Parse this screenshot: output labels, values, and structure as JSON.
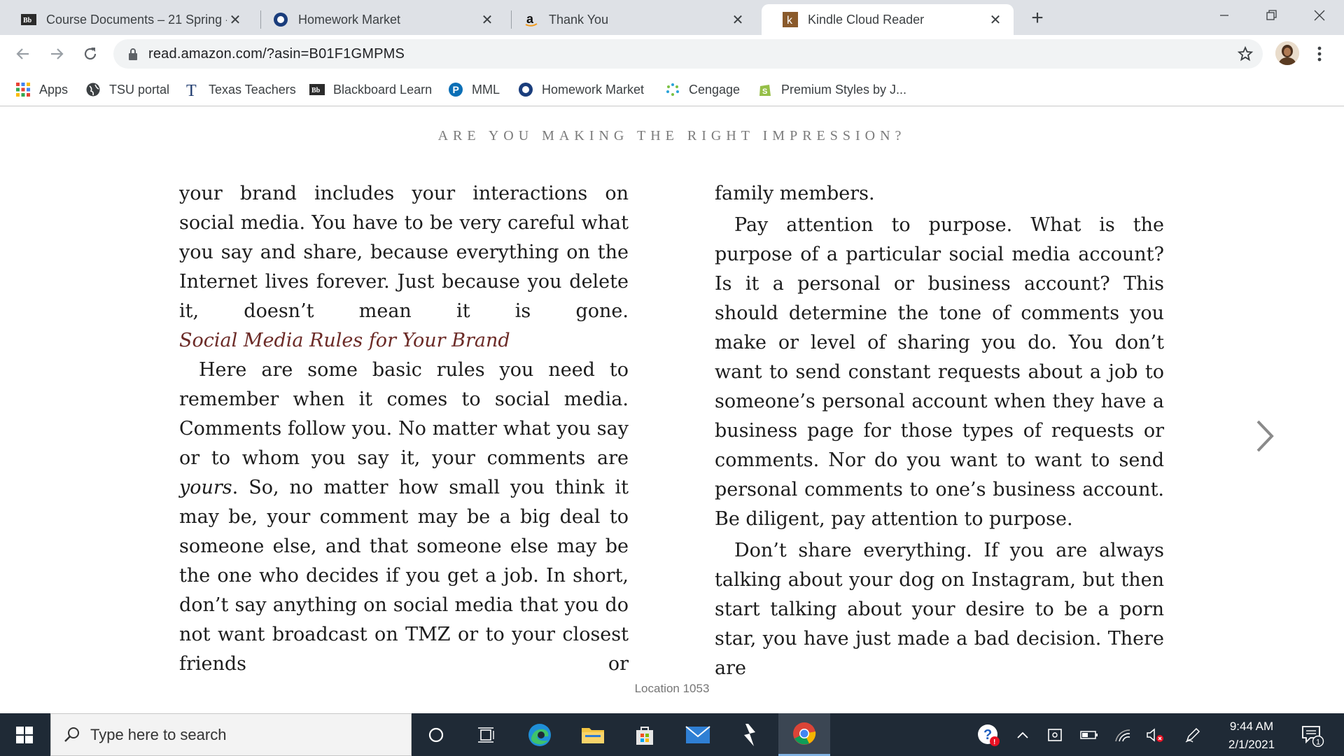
{
  "browser": {
    "tabs": [
      {
        "title": "Course Documents – 21 Spring -",
        "icon": "blackboard-icon",
        "active": false
      },
      {
        "title": "Homework Market",
        "icon": "homework-market-icon",
        "active": false
      },
      {
        "title": "Thank You",
        "icon": "amazon-icon",
        "active": false
      },
      {
        "title": "Kindle Cloud Reader",
        "icon": "kindle-icon",
        "active": true
      }
    ],
    "new_tab_symbol": "+",
    "close_symbol": "✕",
    "address": "read.amazon.com/?asin=B01F1GMPMS",
    "bookmarks": [
      {
        "label": "Apps",
        "icon": "apps-grid-icon"
      },
      {
        "label": "TSU portal",
        "icon": "globe-icon"
      },
      {
        "label": "Texas Teachers",
        "icon": "texas-teachers-icon"
      },
      {
        "label": "Blackboard Learn",
        "icon": "blackboard-icon"
      },
      {
        "label": "MML",
        "icon": "pearson-icon"
      },
      {
        "label": "Homework Market",
        "icon": "homework-market-icon"
      },
      {
        "label": "Cengage",
        "icon": "cengage-icon"
      },
      {
        "label": "Premium Styles by J...",
        "icon": "shopify-icon"
      }
    ]
  },
  "reader": {
    "running_head": "ARE YOU MAKING THE RIGHT IMPRESSION?",
    "left_column": {
      "para1_lines": [
        "your brand includes your interactions on social",
        "media. You have to be very careful what you say",
        "and share, because everything on the Internet",
        "lives forever. Just because you delete it, doesn’t",
        "mean it is gone."
      ],
      "heading": "Social Media Rules for Your Brand",
      "para2_lines": [
        "Here are some basic rules you need to",
        "remember when it comes to social media.",
        "Comments follow you. No matter what you say",
        "or to whom you say it, your comments are"
      ],
      "para2_em": "yours",
      "para2_after_em": ". So, no matter how small you think it may",
      "para2_rest_lines": [
        "be, your comment may be a big deal to someone",
        "else, and that someone else may be the one who",
        "decides if you get a job. In short, don’t say",
        "anything on social media that you do not want",
        "broadcast on TMZ or to your closest friends or"
      ]
    },
    "right_column": {
      "para1_lines": [
        "family members."
      ],
      "para2_lines": [
        "Pay attention to purpose. What is the purpose",
        "of a particular social media account? Is it a",
        "personal or business account? This should",
        "determine the tone of comments you make or",
        "level of sharing you do. You don’t want to send",
        "constant requests about a job to someone’s",
        "personal account when they have a business",
        "page for those types of requests or comments.",
        "Nor do you want to want to send personal",
        "comments to one’s business account. Be",
        "diligent, pay attention to purpose."
      ],
      "para3_lines": [
        "Don’t share everything. If you are always",
        "talking about your dog on Instagram, but then",
        "start talking about your desire to be a porn star,",
        "you have just made a bad decision. There are"
      ]
    },
    "location": "Location 1053"
  },
  "taskbar": {
    "search_placeholder": "Type here to search",
    "time": "9:44 AM",
    "date": "2/1/2021",
    "notification_count": "1"
  },
  "colors": {
    "heading": "#6b2a26",
    "taskbar": "#1f2a36",
    "tabstrip": "#dee1e6"
  }
}
